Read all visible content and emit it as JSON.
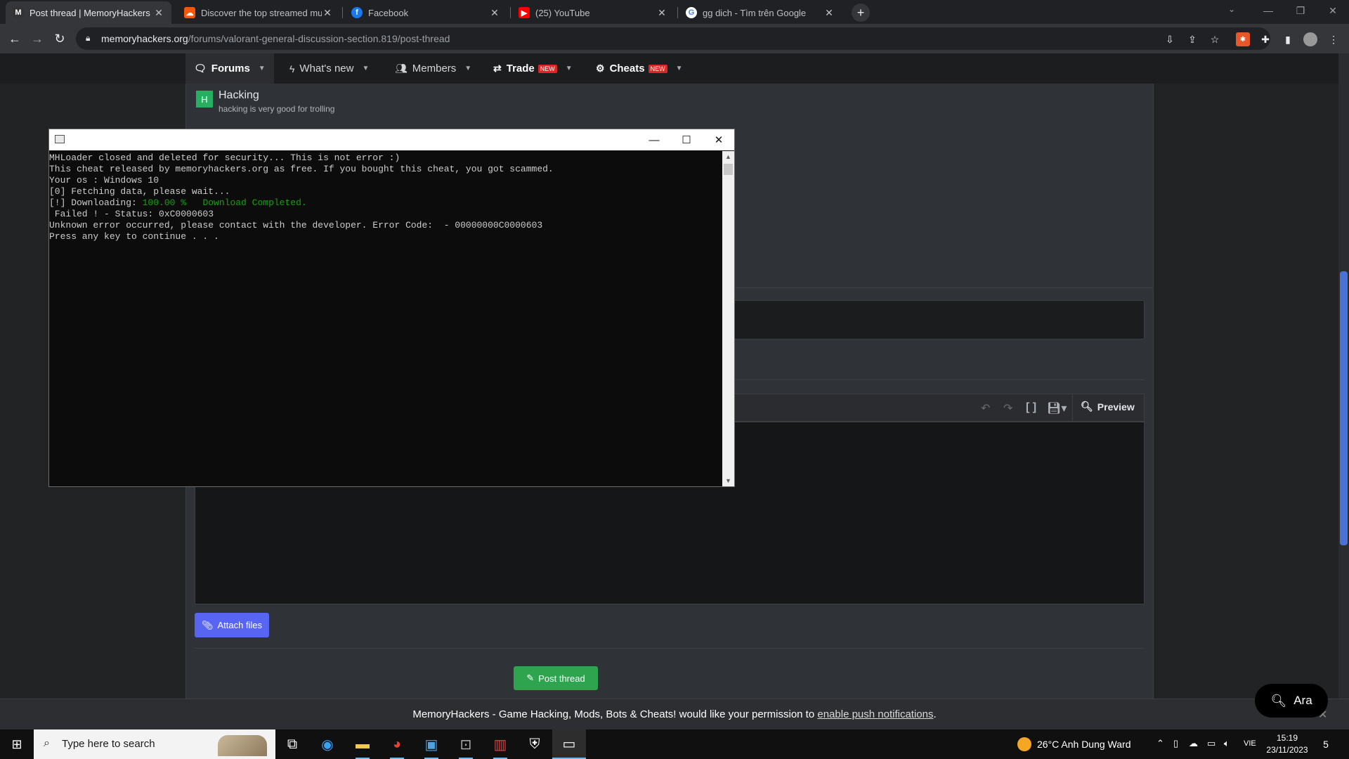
{
  "browser": {
    "tabs": [
      {
        "title": "Post thread | MemoryHackers - G",
        "favicon": "memoryhackers-icon",
        "active": true
      },
      {
        "title": "Discover the top streamed musi",
        "favicon": "soundcloud-icon",
        "active": false
      },
      {
        "title": "Facebook",
        "favicon": "facebook-icon",
        "active": false
      },
      {
        "title": "(25) YouTube",
        "favicon": "youtube-icon",
        "active": false
      },
      {
        "title": "gg dich - Tìm trên Google",
        "favicon": "google-icon",
        "active": false
      }
    ],
    "url_host": "memoryhackers.org",
    "url_path": "/forums/valorant-general-discussion-section.819/post-thread"
  },
  "forum_nav": {
    "items": [
      {
        "label": "Forums",
        "icon": "comments-icon",
        "badge": ""
      },
      {
        "label": "What's new",
        "icon": "bolt-icon",
        "badge": ""
      },
      {
        "label": "Members",
        "icon": "users-icon",
        "badge": ""
      },
      {
        "label": "Trade",
        "icon": "exchange-icon",
        "badge": "NEW"
      },
      {
        "label": "Cheats",
        "icon": "cheats-icon",
        "badge": "NEW"
      }
    ]
  },
  "forum": {
    "avatar_letter": "H",
    "title": "Hacking",
    "description": "hacking is very good for trolling"
  },
  "editor": {
    "preview_label": "Preview",
    "attach_label": "Attach files",
    "post_label": "Post thread"
  },
  "search_fab": {
    "label": "Ara"
  },
  "push_bar": {
    "text": "MemoryHackers - Game Hacking, Mods, Bots & Cheats! would like your permission to ",
    "link": "enable push notifications",
    "suffix": "."
  },
  "console": {
    "lines": [
      "MHLoader closed and deleted for security... This is not error :)",
      "This cheat released by memoryhackers.org as free. If you bought this cheat, you got scammed.",
      "Your os : Windows 10",
      "[0] Fetching data, please wait...",
      " Failed ! - Status: 0xC0000603",
      "Unknown error occurred, please contact with the developer. Error Code:  - 00000000C0000603",
      "Press any key to continue . . ."
    ],
    "download_prefix": "[!] Downloading: ",
    "download_percent": "100.00 %",
    "download_done": "Download Completed."
  },
  "taskbar": {
    "search_placeholder": "Type here to search",
    "weather": "26°C  Anh Dung Ward",
    "language": "VIE",
    "time": "15:19",
    "date": "23/11/2023",
    "notification_count": "5"
  }
}
